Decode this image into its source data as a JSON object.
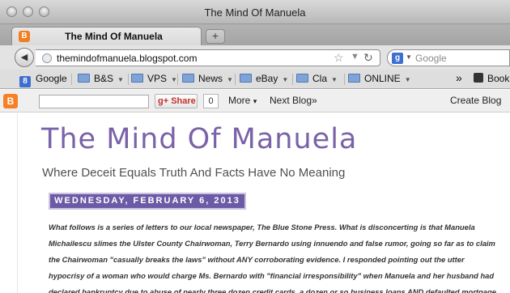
{
  "window": {
    "title": "The Mind Of Manuela"
  },
  "tabs": [
    {
      "title": "The Mind Of Manuela",
      "favicon": "blogger-icon"
    }
  ],
  "newtab_label": "+",
  "navbar": {
    "back_icon": "◀",
    "url": "themindofmanuela.blogspot.com",
    "bookmark_star": "☆",
    "dropdown_arrow": "▼",
    "reload_icon": "↻",
    "search_engine_letter": "g",
    "search_arrow": "▼",
    "search_placeholder": "Google"
  },
  "bookmarks": {
    "items": [
      {
        "label": "Google",
        "type": "google"
      },
      {
        "label": "B&S",
        "type": "folder"
      },
      {
        "label": "VPS",
        "type": "folder"
      },
      {
        "label": "News",
        "type": "folder"
      },
      {
        "label": "eBay",
        "type": "folder"
      },
      {
        "label": "Cla",
        "type": "folder"
      },
      {
        "label": "ONLINE",
        "type": "folder"
      }
    ],
    "caret": "▼",
    "overflow": "»",
    "last_label": "Book"
  },
  "blogger_bar": {
    "logo": "B",
    "search_value": "",
    "share_label": "Share",
    "share_prefix": "g+",
    "share_count": "0",
    "more_label": "More",
    "more_arrow": "▾",
    "next_blog_label": "Next Blog»",
    "create_blog_label": "Create Blog"
  },
  "blog": {
    "title": "The Mind Of Manuela",
    "description": "Where Deceit Equals Truth And Facts Have No Meaning",
    "date_header": "WEDNESDAY, FEBRUARY 6, 2013",
    "post_lines": [
      "What follows is a series of letters to our local newspaper, The Blue Stone Press. What is disconcerting is that Manuela",
      "Michailescu slimes the Ulster County Chairwoman, Terry Bernardo using innuendo and false rumor, going so far as to claim",
      "the Chairwoman \"casually breaks the laws\" without ANY corroborating evidence. I responded pointing out the utter",
      "hypocrisy of a woman who would charge Ms. Bernardo with \"financial irresponsibility\" when Manuela and her husband had",
      "declared bankruptcy due to abuse of nearly three dozen credit cards, a dozen or so business loans AND defaulted mortgage."
    ]
  },
  "colors": {
    "title_purple": "#7a62a8",
    "date_header_bg": "#6b5ba6",
    "blogger_orange": "#f58025"
  }
}
